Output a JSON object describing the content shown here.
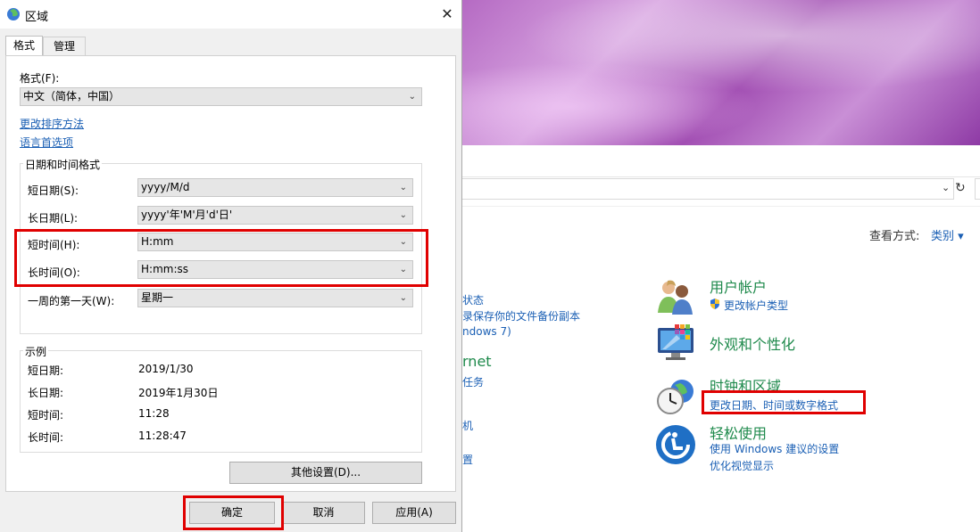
{
  "dialog": {
    "title": "区域",
    "tabs": [
      "格式",
      "管理"
    ],
    "format_label": "格式(F):",
    "format_value": "中文（简体，中国）",
    "links": [
      "更改排序方法",
      "语言首选项"
    ],
    "datetime_group": "日期和时间格式",
    "fields": [
      {
        "label": "短日期(S):",
        "value": "yyyy/M/d"
      },
      {
        "label": "长日期(L):",
        "value": "yyyy'年'M'月'd'日'"
      },
      {
        "label": "短时间(H):",
        "value": "H:mm"
      },
      {
        "label": "长时间(O):",
        "value": "H:mm:ss"
      },
      {
        "label": "一周的第一天(W):",
        "value": "星期一"
      }
    ],
    "example_group": "示例",
    "examples": [
      {
        "label": "短日期:",
        "value": "2019/1/30"
      },
      {
        "label": "长日期:",
        "value": "2019年1月30日"
      },
      {
        "label": "短时间:",
        "value": "11:28"
      },
      {
        "label": "长时间:",
        "value": "11:28:47"
      }
    ],
    "other_settings": "其他设置(D)...",
    "ok": "确定",
    "cancel": "取消",
    "apply": "应用(A)"
  },
  "control_panel": {
    "view_by_label": "查看方式:",
    "view_by_value": "类别 ▾",
    "left_fragments": [
      "状态",
      "录保存你的文件备份副本",
      "ndows 7)",
      "rnet",
      "任务",
      "机",
      "置"
    ],
    "categories": [
      {
        "title": "用户帐户",
        "links": [
          "更改帐户类型"
        ]
      },
      {
        "title": "外观和个性化",
        "links": []
      },
      {
        "title": "时钟和区域",
        "links": [
          "更改日期、时间或数字格式"
        ]
      },
      {
        "title": "轻松使用",
        "links": [
          "使用 Windows 建议的设置",
          "优化视觉显示"
        ]
      }
    ]
  },
  "colors": {
    "highlight": "#e00000",
    "link": "#1a5fb4",
    "category_title": "#1f8a4c"
  }
}
